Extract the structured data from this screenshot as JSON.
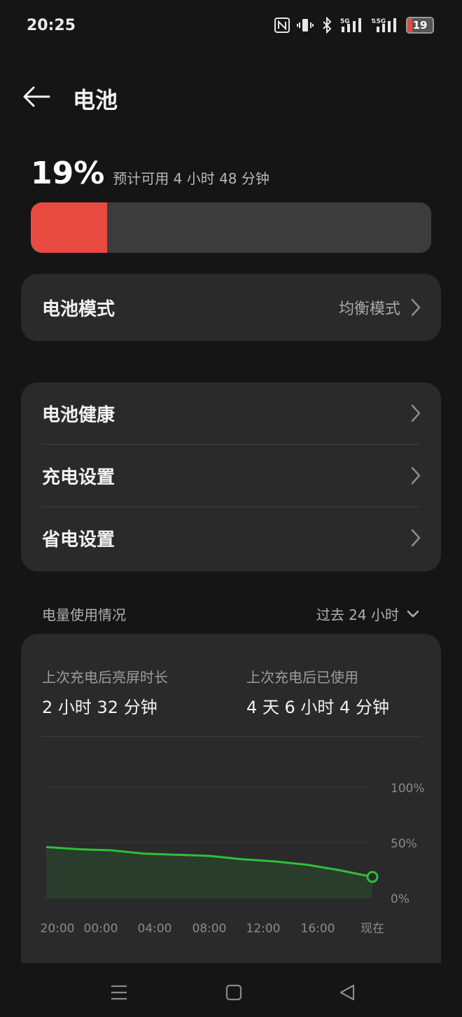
{
  "status_bar": {
    "time": "20:25",
    "icons": [
      "nfc-icon",
      "vibrate-icon",
      "bluetooth-icon",
      "signal-5g-icon",
      "signal-5g-icon"
    ],
    "battery_level": "19"
  },
  "header": {
    "title": "电池",
    "back_icon": "arrow-left-icon"
  },
  "battery": {
    "percent": "19%",
    "estimate": "预计可用 4 小时 48 分钟",
    "level_fraction": 0.19,
    "level_color": "#e94a3f"
  },
  "mode_card": {
    "label": "电池模式",
    "value": "均衡模式"
  },
  "settings_card": {
    "items": [
      {
        "label": "电池健康"
      },
      {
        "label": "充电设置"
      },
      {
        "label": "省电设置"
      }
    ]
  },
  "usage": {
    "title": "电量使用情况",
    "range": "过去 24 小时",
    "screen_on_label": "上次充电后亮屏时长",
    "screen_on_value": "2 小时 32 分钟",
    "used_label": "上次充电后已使用",
    "used_value": "4 天 6 小时 4 分钟"
  },
  "chart_data": {
    "type": "area",
    "x": [
      "20:00",
      "00:00",
      "04:00",
      "08:00",
      "12:00",
      "16:00",
      "现在"
    ],
    "y_ticks": [
      "100%",
      "50%",
      "0%"
    ],
    "ylim": [
      0,
      100
    ],
    "series": [
      {
        "values": [
          46,
          44,
          43,
          40,
          39,
          38,
          35,
          33,
          30,
          25,
          19
        ]
      }
    ],
    "line_color": "#2fbf3b",
    "grid": true,
    "legend": "none"
  },
  "nav_bar": {
    "icons": [
      "menu-icon",
      "home-icon",
      "back-triangle-icon"
    ]
  }
}
